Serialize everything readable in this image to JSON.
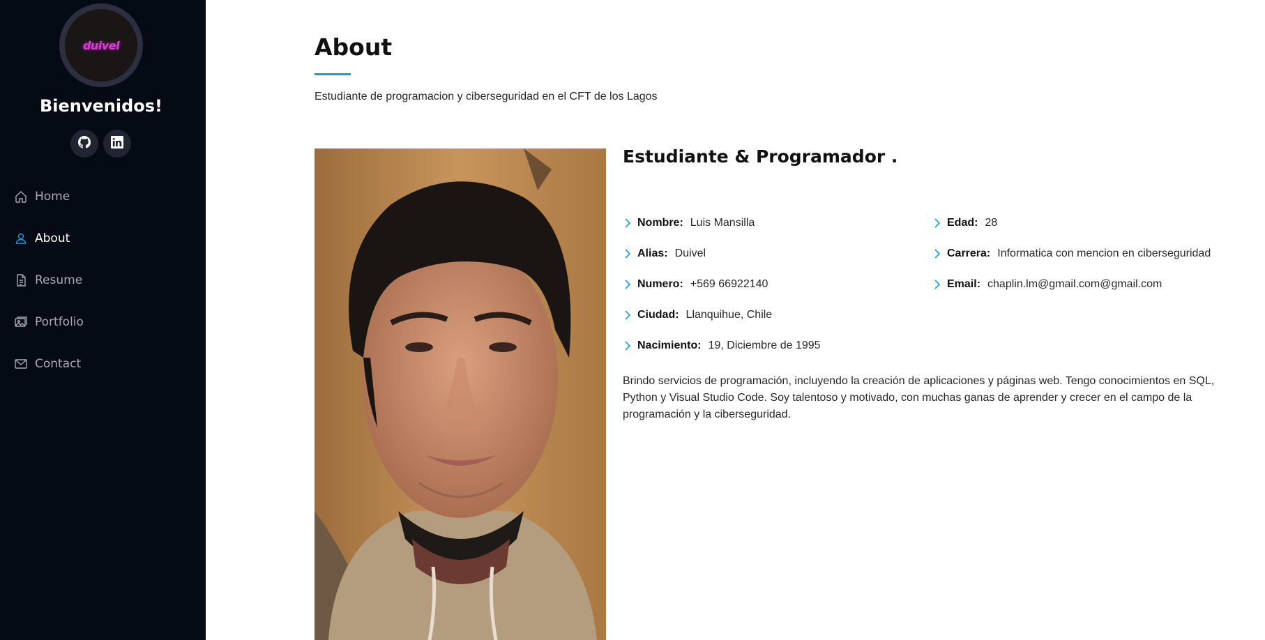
{
  "sidebar": {
    "logo_text": "duivel",
    "welcome": "Bienvenidos!",
    "social": [
      {
        "name": "github-icon"
      },
      {
        "name": "linkedin-icon"
      }
    ],
    "nav": [
      {
        "label": "Home",
        "icon": "home-icon",
        "active": false
      },
      {
        "label": "About",
        "icon": "person-icon",
        "active": true
      },
      {
        "label": "Resume",
        "icon": "file-icon",
        "active": false
      },
      {
        "label": "Portfolio",
        "icon": "images-icon",
        "active": false
      },
      {
        "label": "Contact",
        "icon": "envelope-icon",
        "active": false
      }
    ]
  },
  "about": {
    "title": "About",
    "intro": "Estudiante de programacion y ciberseguridad en el CFT de los Lagos",
    "heading": "Estudiante & Programador .",
    "left_info": [
      {
        "label": "Nombre:",
        "value": "Luis Mansilla"
      },
      {
        "label": "Alias:",
        "value": "Duivel"
      },
      {
        "label": "Numero:",
        "value": "+569 66922140"
      },
      {
        "label": "Ciudad:",
        "value": "Llanquihue, Chile"
      },
      {
        "label": "Nacimiento:",
        "value": "19, Diciembre de 1995"
      }
    ],
    "right_info": [
      {
        "label": "Edad:",
        "value": "28"
      },
      {
        "label": "Carrera:",
        "value": "Informatica con mencion en ciberseguridad"
      },
      {
        "label": "Email:",
        "value": "chaplin.lm@gmail.com@gmail.com"
      }
    ],
    "description": "Brindo servicios de programación, incluyendo la creación de aplicaciones y páginas web. Tengo conocimientos en SQL, Python y Visual Studio Code. Soy talentoso y motivado, con muchas ganas de aprender y crecer en el campo de la programación y la ciberseguridad."
  },
  "colors": {
    "sidebar_bg": "#040b14",
    "accent": "#149ddd",
    "nav_text": "#a8a9b4",
    "logo": "#d63fd0"
  }
}
